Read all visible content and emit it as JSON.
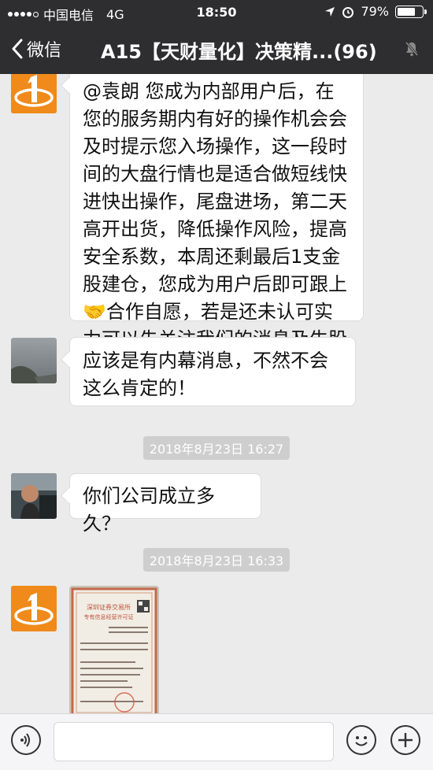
{
  "status_bar": {
    "carrier": "中国电信",
    "network": "4G",
    "time": "18:50",
    "battery_percent": "79%",
    "battery_level": 0.79
  },
  "nav": {
    "back_label": "微信",
    "title": "A15【天财量化】决策精...(96)",
    "mute_icon": "mute-bell-icon"
  },
  "messages": [
    {
      "type": "text",
      "sender_avatar": "logo",
      "text": "@袁朗  您成为内部用户后，在您的服务期内有好的操作机会会及时提示您入场操作，这一段时间的大盘行情也是适合做短线快进快出操作，尾盘进场，第二天高开出货，降低操作风险，提高安全系数，本周还剩最后1支金股建仓，您成为用户后即可跟上🤝合作自愿，若是还未认可实力可以先关注我们的消息及牛股实力。"
    },
    {
      "type": "text",
      "sender_avatar": "landscape",
      "text": "应该是有内幕消息，不然不会这么肯定的！"
    },
    {
      "type": "timestamp",
      "text": "2018年8月23日 16:27"
    },
    {
      "type": "text",
      "sender_avatar": "person",
      "text": "你们公司成立多久？"
    },
    {
      "type": "timestamp",
      "text": "2018年8月23日 16:33"
    },
    {
      "type": "image",
      "sender_avatar": "logo",
      "image_title": "深圳证券交易所专有信息经营许可证"
    }
  ],
  "input_bar": {
    "voice_icon": "voice-icon",
    "emoji_icon": "emoji-icon",
    "plus_icon": "plus-icon"
  },
  "colors": {
    "nav_bg": "#2e2e30",
    "chat_bg": "#ebebeb",
    "logo_orange": "#f08a1a"
  }
}
